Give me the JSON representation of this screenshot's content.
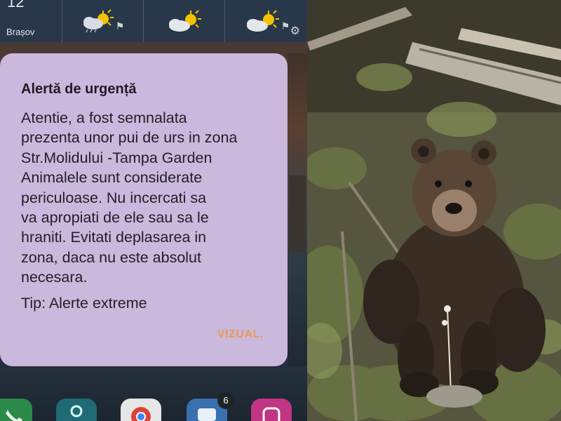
{
  "status_bar": {
    "clock_fragment": "12",
    "city": "Brașov"
  },
  "weather": {
    "icons": [
      "partly-cloudy-rain-icon",
      "partly-cloudy-icon",
      "partly-cloudy-icon"
    ],
    "settings_icon": "gear-icon"
  },
  "alert": {
    "title": "Alertă de urgență",
    "body": "Atentie, a fost semnalata\nprezenta unor pui de urs in zona\nStr.Molidului -Tampa Garden\nAnimalele sunt considerate\npericuloase. Nu incercati sa\nva apropiati de ele sau sa le\nhraniti. Evitati deplasarea in\nzona, daca nu este absolut\nnecesara.",
    "type_line": "Tip: Alerte extreme",
    "button_label": "VIZUAL."
  },
  "dock": {
    "icons": [
      "phone-icon",
      "maps-icon",
      "chrome-icon",
      "messages-icon",
      "instagram-icon"
    ],
    "messages_badge": "6"
  },
  "colors": {
    "dialog_bg": "#cbb8dd",
    "button_text": "#e89a54"
  },
  "photo": {
    "subject": "brown-bear-photo"
  }
}
